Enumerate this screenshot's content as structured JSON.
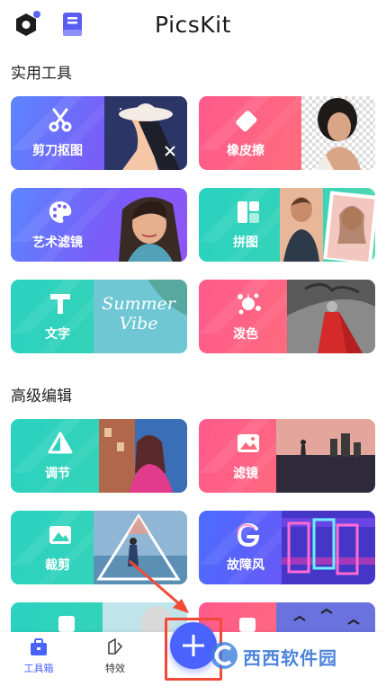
{
  "header": {
    "title": "PicsKit",
    "hex_icon": "hexagon-settings-icon",
    "book_icon": "book-icon"
  },
  "sections": [
    {
      "title": "实用工具"
    },
    {
      "title": "高级编辑"
    }
  ],
  "tools": [
    {
      "label": "剪刀抠图",
      "icon": "scissors-icon",
      "theme": "purple"
    },
    {
      "label": "橡皮擦",
      "icon": "eraser-icon",
      "theme": "pink"
    },
    {
      "label": "艺术滤镜",
      "icon": "palette-icon",
      "theme": "purple"
    },
    {
      "label": "拼图",
      "icon": "collage-icon",
      "theme": "teal"
    },
    {
      "label": "文字",
      "icon": "text-t-icon",
      "theme": "teal",
      "art_text": "Summer Vibe"
    },
    {
      "label": "泼色",
      "icon": "splash-icon",
      "theme": "pink"
    }
  ],
  "advanced": [
    {
      "label": "调节",
      "icon": "adjust-triangle-icon",
      "theme": "teal"
    },
    {
      "label": "滤镜",
      "icon": "filter-image-icon",
      "theme": "pink"
    },
    {
      "label": "裁剪",
      "icon": "crop-mountain-icon",
      "theme": "teal"
    },
    {
      "label": "故障风",
      "icon": "glitch-g-icon",
      "theme": "blue"
    }
  ],
  "tabbar": {
    "tabs": [
      {
        "label": "工具箱",
        "icon": "toolbox-icon",
        "active": true
      },
      {
        "label": "特效",
        "icon": "effects-icon",
        "active": false
      }
    ],
    "fab_icon": "plus-icon"
  },
  "watermark_text": "西西软件园",
  "colors": {
    "accent": "#4a63ff",
    "annotation_red": "#f24a37"
  }
}
